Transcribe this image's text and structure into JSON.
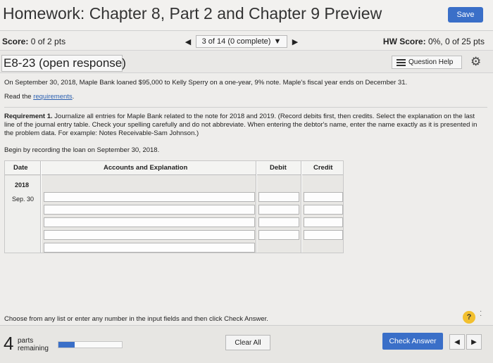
{
  "header": {
    "title": "Homework: Chapter 8, Part 2 and Chapter 9 Preview",
    "save_label": "Save"
  },
  "score_bar": {
    "score_label": "Score:",
    "score_value": "0 of 2 pts",
    "pager_text": "3 of 14 (0 complete)",
    "hw_label": "HW Score:",
    "hw_value": "0%, 0 of 25 pts"
  },
  "question": {
    "title": "E8-23 (open response)",
    "help_label": "Question Help"
  },
  "content": {
    "problem_text": "On September 30, 2018, Maple Bank loaned $95,000 to Kelly Sperry on a one-year, 9% note. Maple's fiscal year ends on December 31.",
    "read_prefix": "Read the ",
    "read_link": "requirements",
    "read_suffix": ".",
    "requirement_label": "Requirement 1.",
    "requirement_text": " Journalize all entries for Maple Bank related to the note for 2018 and 2019. (Record debits first, then credits. Select the explanation on the last line of the journal entry table. Check your spelling carefully and do not abbreviate. When entering the debtor's name, enter the name exactly as it is presented in the problem data. For example: Notes Receivable-Sam Johnson.)",
    "begin_text": "Begin by recording the loan on September 30, 2018."
  },
  "journal": {
    "headers": {
      "date": "Date",
      "accounts": "Accounts and Explanation",
      "debit": "Debit",
      "credit": "Credit"
    },
    "year": "2018",
    "date": "Sep. 30"
  },
  "footer": {
    "choose_text": "Choose from any list or enter any number in the input fields and then click Check Answer.",
    "parts_count": "4",
    "parts_label_1": "parts",
    "parts_label_2": "remaining",
    "progress_fraction": 0.25,
    "clear_label": "Clear All",
    "check_label": "Check Answer"
  },
  "colors": {
    "accent": "#3a6fc8",
    "help_badge": "#f2c02f",
    "link": "#2a5fb0"
  },
  "icons": [
    "caret-left-icon",
    "caret-down-icon",
    "caret-right-icon",
    "list-icon",
    "gear-icon",
    "question-icon"
  ]
}
